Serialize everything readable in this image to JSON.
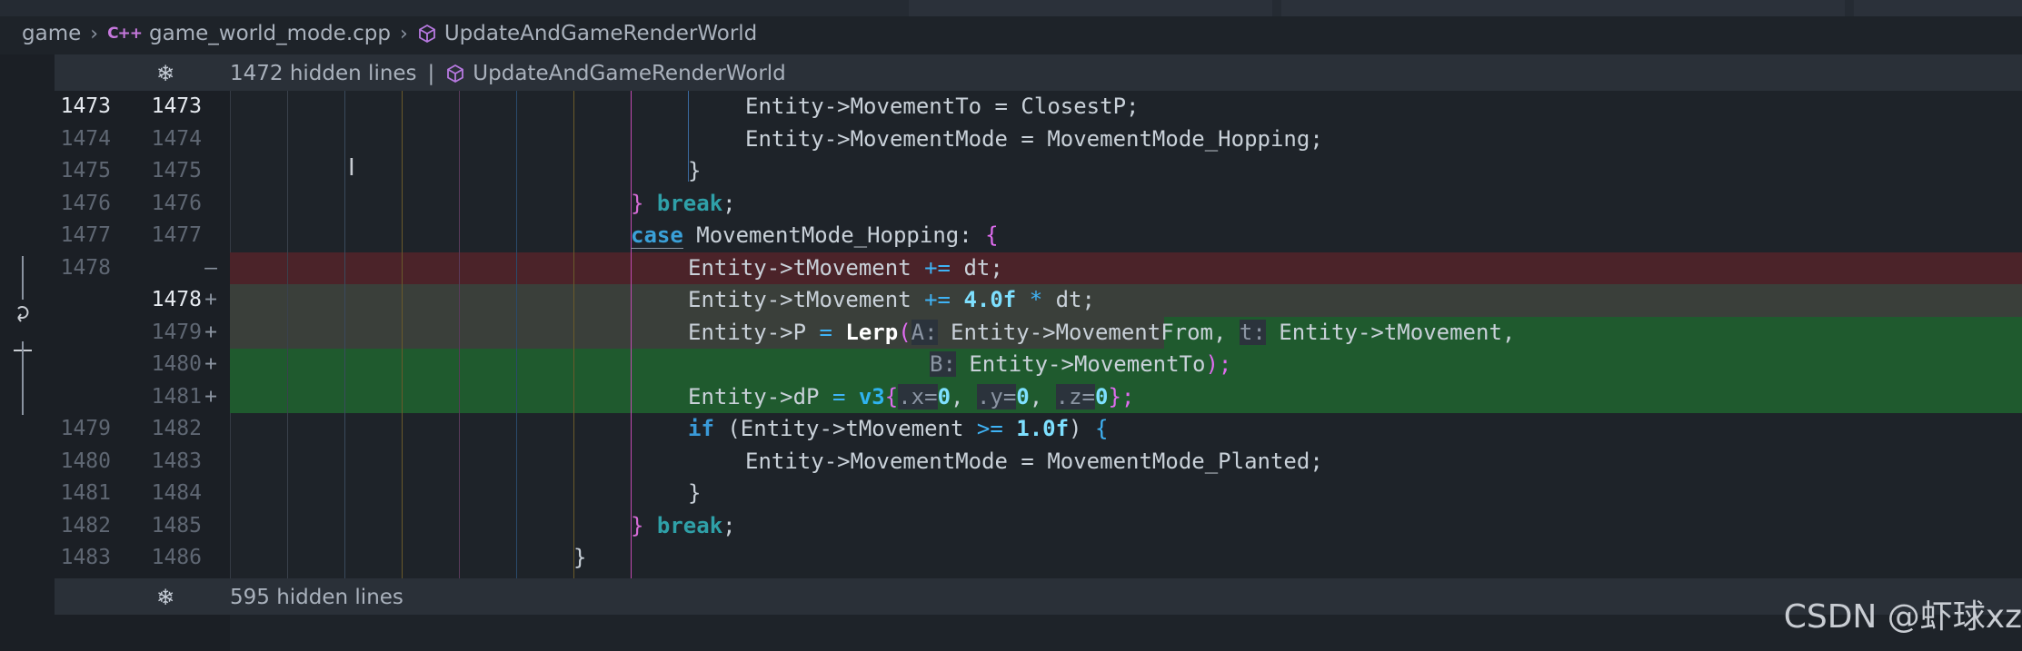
{
  "breadcrumb": {
    "folder": "game",
    "file_icon": "C++",
    "file": "game_world_mode.cpp",
    "symbol": "UpdateAndGameRenderWorld"
  },
  "top_banner": {
    "hidden": "1472 hidden lines",
    "separator": "|",
    "symbol": "UpdateAndGameRenderWorld"
  },
  "bottom_banner": {
    "hidden": "595 hidden lines"
  },
  "lines": [
    {
      "old": "1473",
      "new": "1473",
      "mark": "",
      "kind": "ctx",
      "current": true
    },
    {
      "old": "1474",
      "new": "1474",
      "mark": "",
      "kind": "ctx"
    },
    {
      "old": "1475",
      "new": "1475",
      "mark": "",
      "kind": "ctx"
    },
    {
      "old": "1476",
      "new": "1476",
      "mark": "",
      "kind": "ctx"
    },
    {
      "old": "1477",
      "new": "1477",
      "mark": "",
      "kind": "ctx"
    },
    {
      "old": "1478",
      "new": "",
      "mark": "—",
      "kind": "del"
    },
    {
      "old": "",
      "new": "1478",
      "mark": "+",
      "kind": "mod"
    },
    {
      "old": "",
      "new": "1479",
      "mark": "+",
      "kind": "add"
    },
    {
      "old": "",
      "new": "1480",
      "mark": "+",
      "kind": "add"
    },
    {
      "old": "",
      "new": "1481",
      "mark": "+",
      "kind": "add"
    },
    {
      "old": "1479",
      "new": "1482",
      "mark": "",
      "kind": "ctx"
    },
    {
      "old": "1480",
      "new": "1483",
      "mark": "",
      "kind": "ctx"
    },
    {
      "old": "1481",
      "new": "1484",
      "mark": "",
      "kind": "ctx"
    },
    {
      "old": "1482",
      "new": "1485",
      "mark": "",
      "kind": "ctx"
    },
    {
      "old": "1483",
      "new": "1486",
      "mark": "",
      "kind": "ctx"
    }
  ],
  "code": {
    "l1": "Entity->MovementTo = ClosestP;",
    "l2": "Entity->MovementMode = MovementMode_Hopping;",
    "l3": "}",
    "l4a": "}",
    "l4b": "break",
    "l4c": ";",
    "l5a": "case",
    "l5b": " MovementMode_Hopping: ",
    "l5c": "{",
    "l6a": "Entity->tMovement ",
    "l6b": "+=",
    "l6c": " dt;",
    "l7a": "Entity->tMovement ",
    "l7b": "+=",
    "l7c": "4.0f",
    "l7d": "*",
    "l7e": " dt;",
    "l8a": "Entity->P ",
    "l8b": "=",
    "l8c": "Lerp",
    "l8d": "(",
    "l8e": "A:",
    "l8f": " Entity->MovementFrom, ",
    "l8g": "t:",
    "l8h": " Entity->tMovement,",
    "l9a": "B:",
    "l9b": " Entity->MovementTo",
    "l9c": ");",
    "l10a": "Entity->dP ",
    "l10b": "=",
    "l10c": "v3",
    "l10d": "{",
    "l10e": ".x=",
    "l10f": "0",
    "l10g": ", ",
    "l10h": ".y=",
    "l10i": "0",
    "l10j": ", ",
    "l10k": ".z=",
    "l10l": "0",
    "l10m": "};",
    "l11a": "if",
    "l11b": " (Entity->tMovement ",
    "l11c": ">=",
    "l11d": "1.0f",
    "l11e": ") ",
    "l11f": "{",
    "l12": "Entity->MovementMode = MovementMode_Planted;",
    "l13": "}",
    "l14a": "}",
    "l14b": "break",
    "l14c": ";",
    "l15": "}"
  },
  "watermark": "CSDN @虾球xz",
  "colors": {
    "deleted": "#4b2329",
    "added": "#1f5a2e",
    "modified": "#3a3f3a",
    "background": "#1e2329"
  }
}
